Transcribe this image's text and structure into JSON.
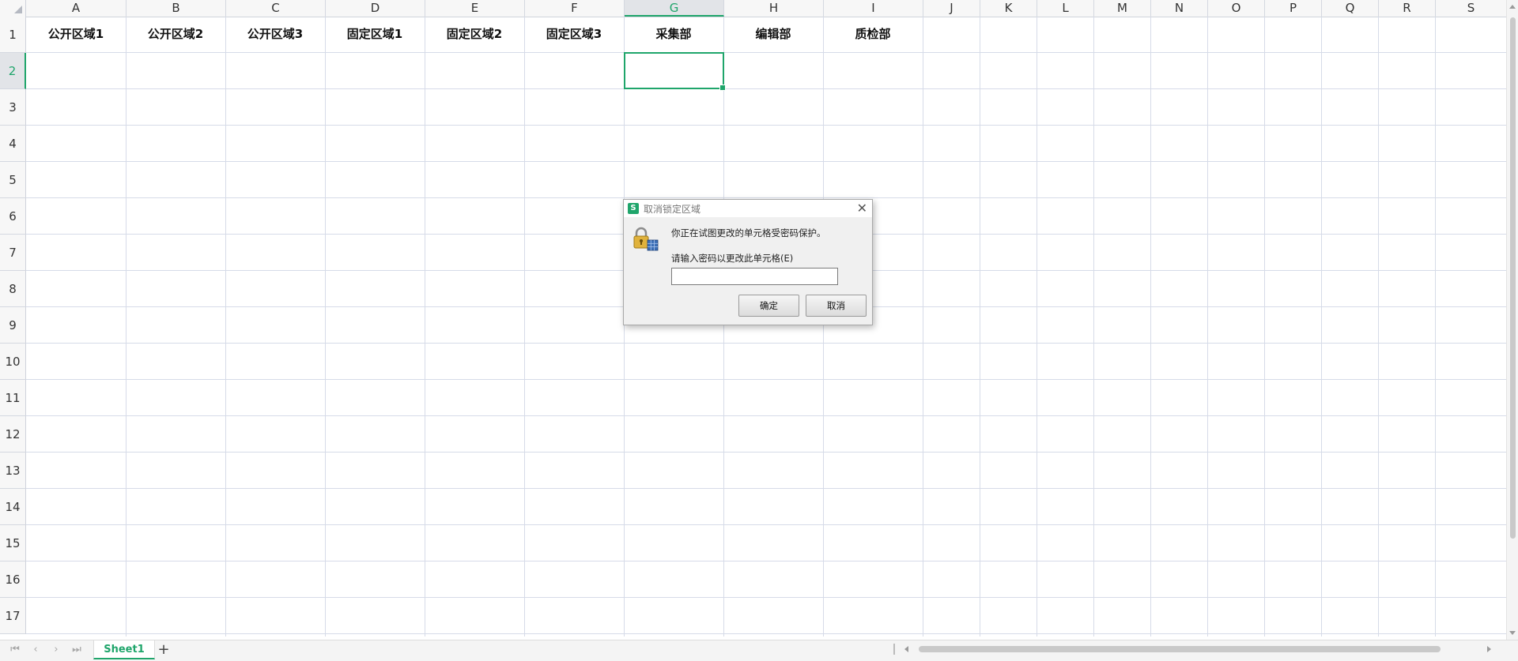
{
  "columns": [
    "A",
    "B",
    "C",
    "D",
    "E",
    "F",
    "G",
    "H",
    "I",
    "J",
    "K",
    "L",
    "M",
    "N",
    "O",
    "P",
    "Q",
    "R",
    "S"
  ],
  "rows": [
    "1",
    "2",
    "3",
    "4",
    "5",
    "6",
    "7",
    "8",
    "9",
    "10",
    "11",
    "12",
    "13",
    "14",
    "15",
    "16",
    "17"
  ],
  "selected_column": "G",
  "selected_row": "2",
  "header_cells": [
    "公开区域1",
    "公开区域2",
    "公开区域3",
    "固定区域1",
    "固定区域2",
    "固定区域3",
    "采集部",
    "编辑部",
    "质检部"
  ],
  "sheet": {
    "tab_label": "Sheet1",
    "add_icon": "plus-icon"
  },
  "dialog": {
    "title": "取消锁定区域",
    "app_logo_letter": "S",
    "message": "你正在试图更改的单元格受密码保护。",
    "prompt": "请输入密码以更改此单元格(E)",
    "password_value": "",
    "ok_label": "确定",
    "cancel_label": "取消",
    "icon": "lock-icon"
  },
  "colors": {
    "accent": "#1fa56b",
    "grid": "#d6dbe8",
    "header_bg": "#f7f7f7"
  }
}
